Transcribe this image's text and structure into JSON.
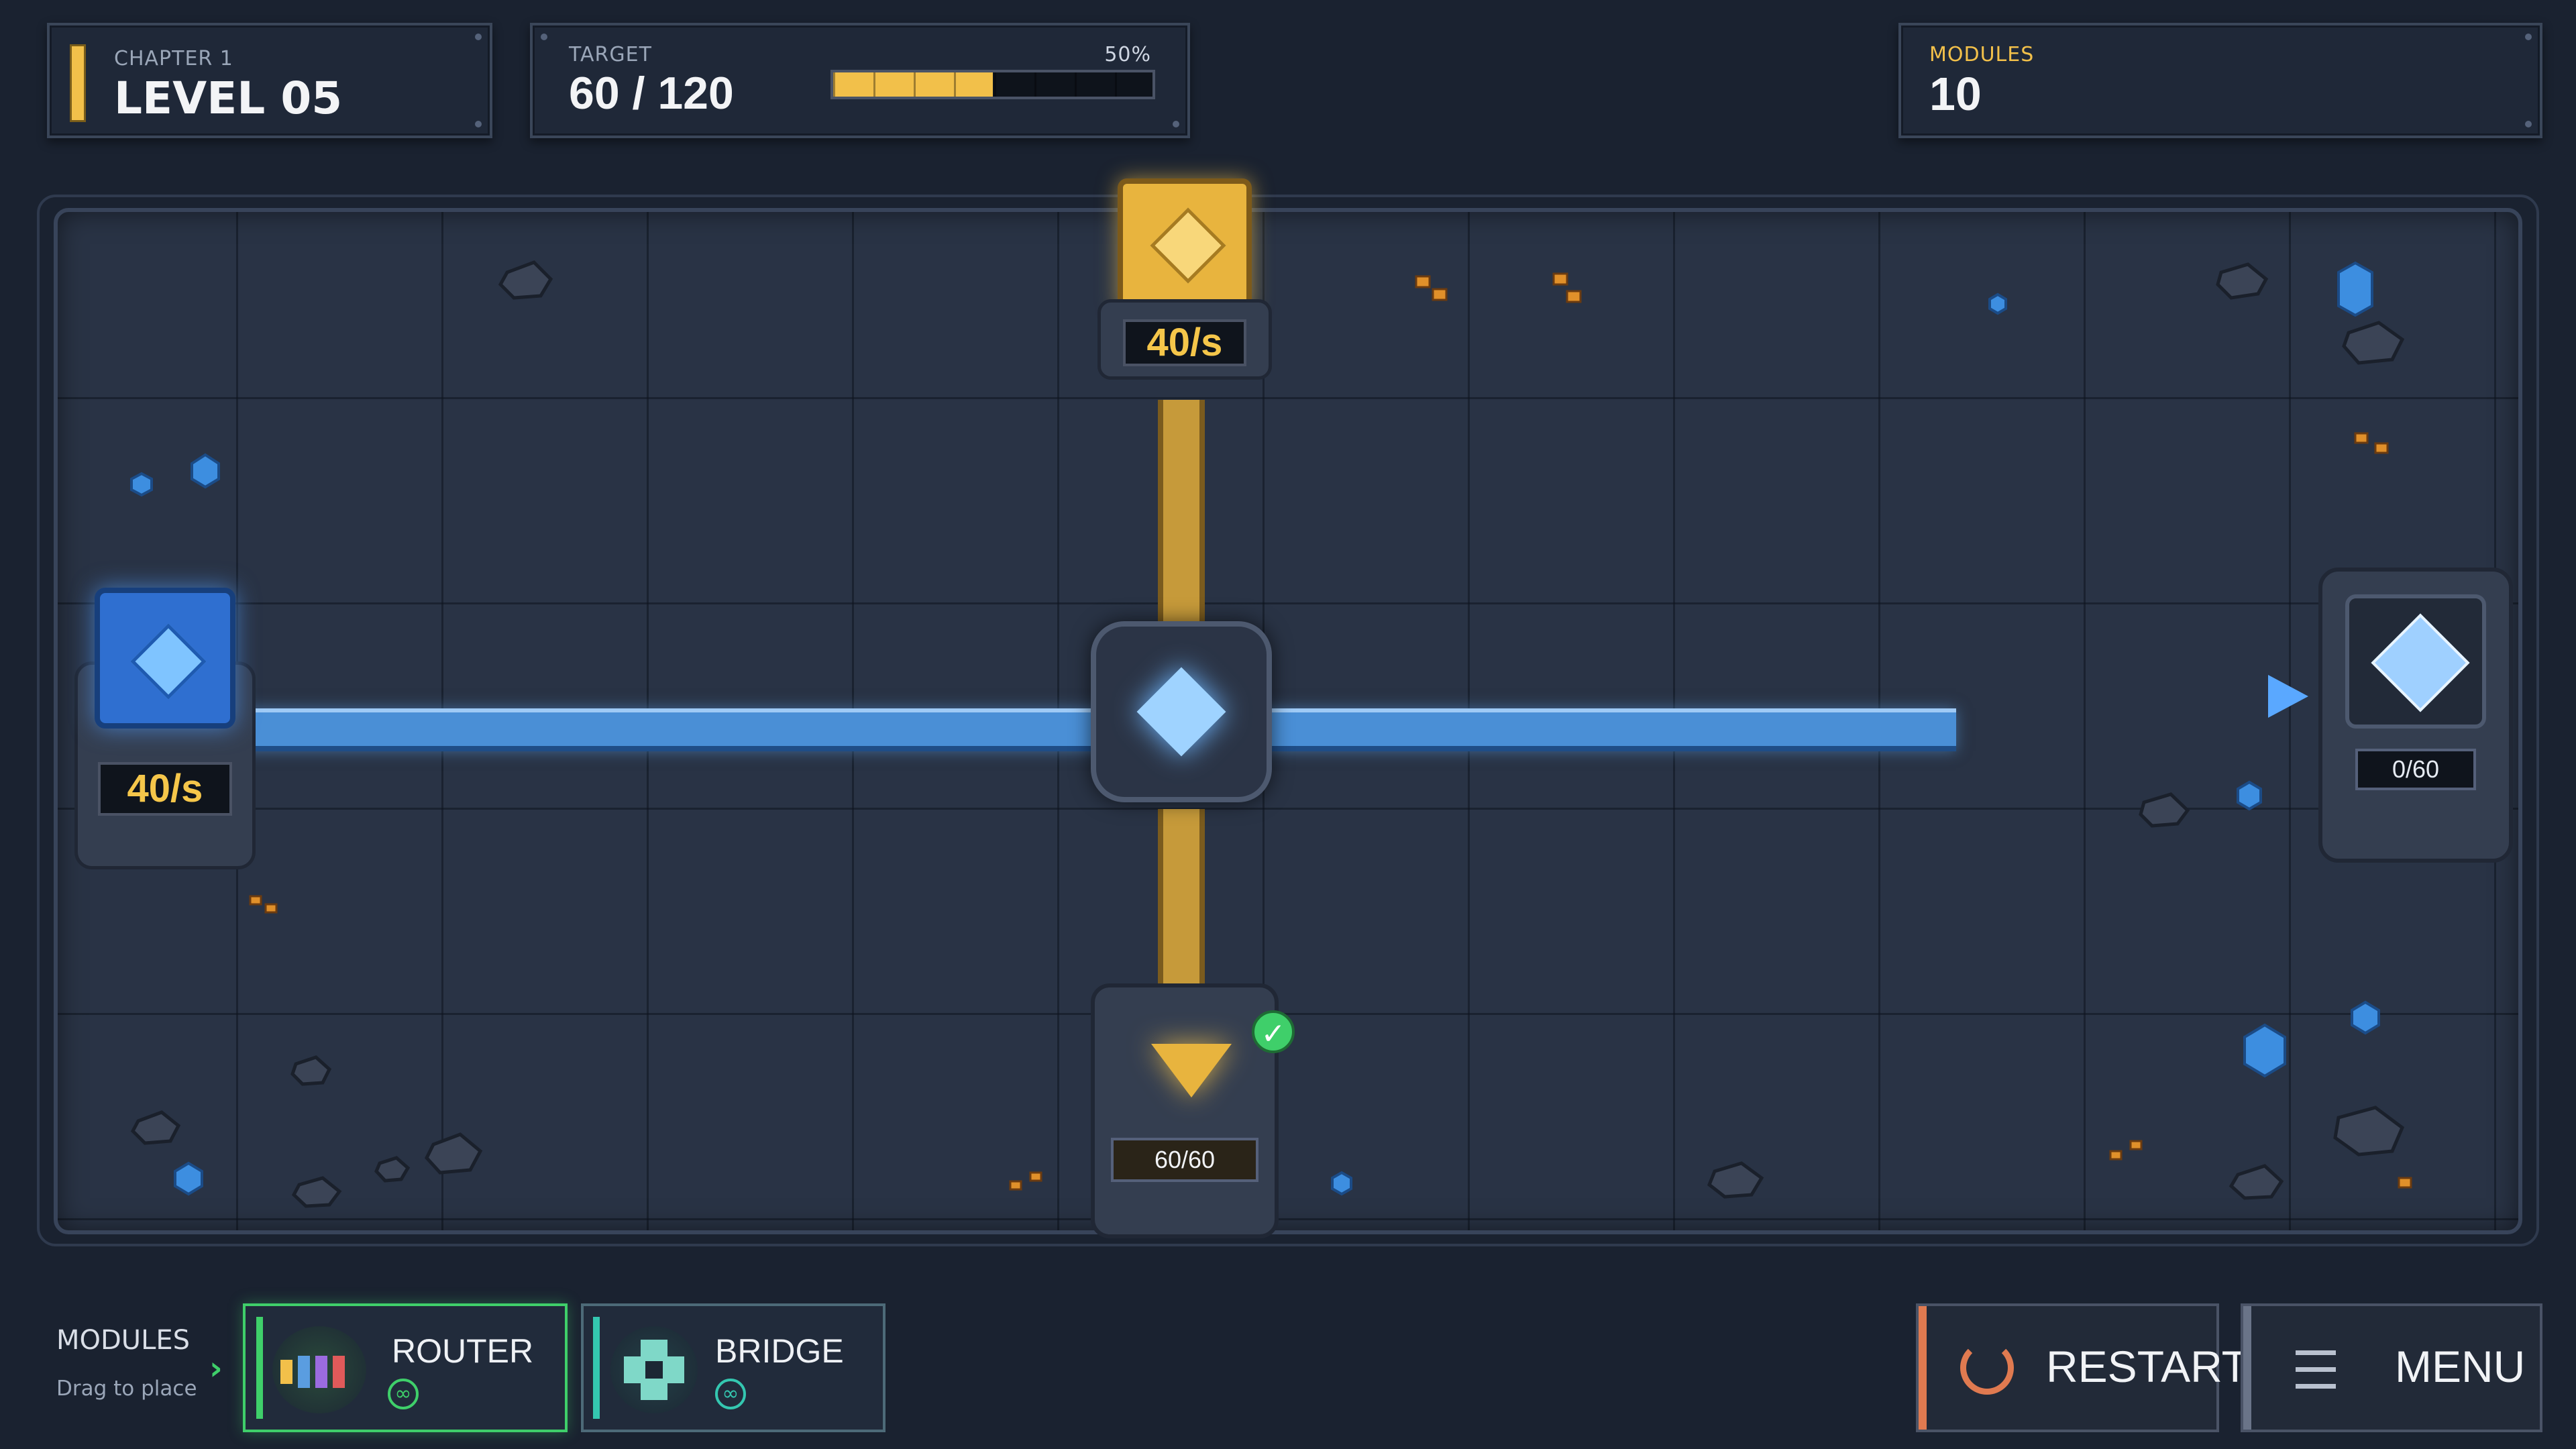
{
  "hud": {
    "chapter": "CHAPTER 1",
    "level": "LEVEL 05",
    "target_label": "TARGET",
    "target_value": "60 / 120",
    "progress_percent_label": "50%",
    "progress_fraction": 0.5,
    "modules_label": "MODULES",
    "modules_count": "10"
  },
  "board": {
    "gold_source_rate": "40/s",
    "blue_source_rate": "40/s",
    "gold_sink_count": "60/60",
    "blue_sink_count": "0/60"
  },
  "toolbar": {
    "modules_label": "MODULES",
    "modules_hint": "Drag to place",
    "modules": [
      {
        "name": "ROUTER",
        "count": "∞"
      },
      {
        "name": "BRIDGE",
        "count": "∞"
      }
    ],
    "restart_label": "RESTART",
    "menu_label": "MENU"
  },
  "colors": {
    "gold": "#f2c04a",
    "blue": "#5a9de0",
    "success": "#3fcf6a",
    "router_accent": "#3fcf6a",
    "bridge_accent": "#34c7b0",
    "restart_accent": "#e07a50"
  }
}
